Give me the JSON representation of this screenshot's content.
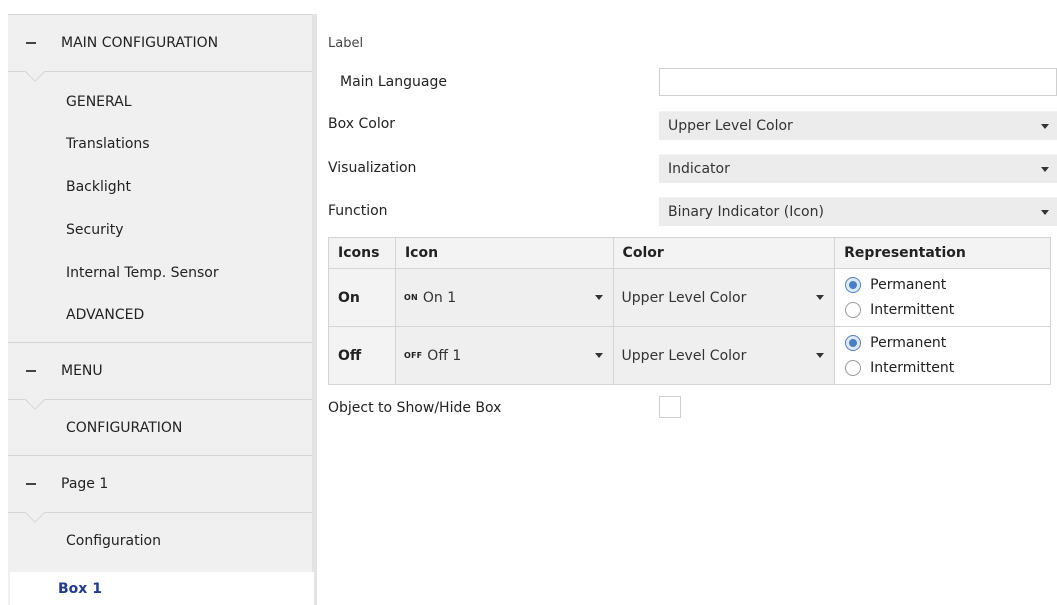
{
  "sidebar": {
    "sections": [
      {
        "label": "MAIN CONFIGURATION",
        "items": [
          "GENERAL",
          "Translations",
          "Backlight",
          "Security",
          "Internal Temp. Sensor",
          "ADVANCED"
        ]
      },
      {
        "label": "MENU",
        "items": [
          "CONFIGURATION"
        ]
      },
      {
        "label": "Page 1",
        "items": [
          "Configuration",
          "Box 1"
        ]
      }
    ],
    "active_item": "Box 1"
  },
  "form": {
    "label_heading": "Label",
    "main_language": {
      "label": "Main Language",
      "value": ""
    },
    "box_color": {
      "label": "Box Color",
      "value": "Upper Level Color"
    },
    "visualization": {
      "label": "Visualization",
      "value": "Indicator"
    },
    "function": {
      "label": "Function",
      "value": "Binary Indicator (Icon)"
    },
    "object_show_hide": {
      "label": "Object to Show/Hide Box",
      "checked": false
    }
  },
  "icons_table": {
    "headers": [
      "Icons",
      "Icon",
      "Color",
      "Representation"
    ],
    "rows": [
      {
        "label": "On",
        "icon_glyph": "ON",
        "icon_value": "On 1",
        "color": "Upper Level Color",
        "options": [
          "Permanent",
          "Intermittent"
        ],
        "selected": "Permanent"
      },
      {
        "label": "Off",
        "icon_glyph": "OFF",
        "icon_value": "Off 1",
        "color": "Upper Level Color",
        "options": [
          "Permanent",
          "Intermittent"
        ],
        "selected": "Permanent"
      }
    ]
  },
  "colors": {
    "active_nav": "#1f3a93",
    "sidebar_bg": "#f0f0f0",
    "radio_accent": "#4a7fc6"
  }
}
